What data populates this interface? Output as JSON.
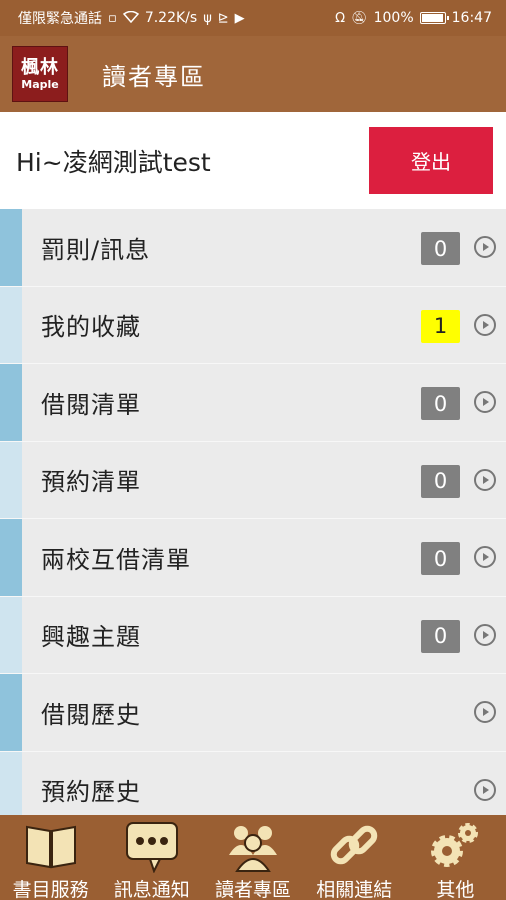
{
  "status_bar": {
    "carrier": "僅限緊急通話",
    "net_speed": "7.22K/s",
    "battery_percent": "100%",
    "battery_level": 1.0,
    "time": "16:47"
  },
  "app_bar": {
    "logo_cn": "楓林",
    "logo_en": "Maple",
    "title": "讀者專區"
  },
  "user": {
    "greeting": "Hi~凌網測試test",
    "logout_label": "登出"
  },
  "menu": [
    {
      "label": "罰則/訊息",
      "count": "0",
      "highlight": false
    },
    {
      "label": "我的收藏",
      "count": "1",
      "highlight": true
    },
    {
      "label": "借閱清單",
      "count": "0",
      "highlight": false
    },
    {
      "label": "預約清單",
      "count": "0",
      "highlight": false
    },
    {
      "label": "兩校互借清單",
      "count": "0",
      "highlight": false
    },
    {
      "label": "興趣主題",
      "count": "0",
      "highlight": false
    },
    {
      "label": "借閱歷史",
      "count": null,
      "highlight": false
    },
    {
      "label": "預約歷史",
      "count": null,
      "highlight": false
    }
  ],
  "bottom_nav": [
    {
      "label": "書目服務",
      "icon": "book-icon"
    },
    {
      "label": "訊息通知",
      "icon": "chat-bubble-icon"
    },
    {
      "label": "讀者專區",
      "icon": "users-icon"
    },
    {
      "label": "相關連結",
      "icon": "link-icon"
    },
    {
      "label": "其他",
      "icon": "gears-icon"
    }
  ],
  "colors": {
    "brand_brown": "#9a5f33",
    "logout_red": "#dc1f3f",
    "badge_gray": "#808080",
    "badge_highlight": "#ffff00",
    "accent_blue": "#8fc3dc",
    "nav_icon_cream": "#f3e3b5"
  }
}
